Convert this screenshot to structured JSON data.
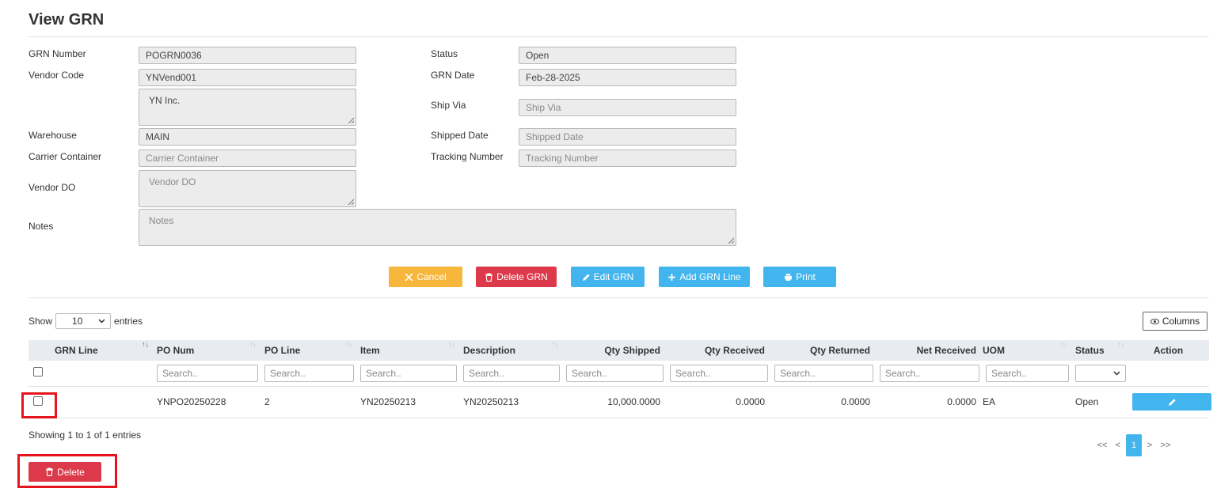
{
  "page": {
    "title": "View GRN"
  },
  "form": {
    "grn_number_label": "GRN Number",
    "grn_number": "POGRN0036",
    "vendor_code_label": "Vendor Code",
    "vendor_code": "YNVend001",
    "vendor_name": "YN Inc.",
    "warehouse_label": "Warehouse",
    "warehouse": "MAIN",
    "carrier_container_label": "Carrier Container",
    "carrier_container_placeholder": "Carrier Container",
    "vendor_do_label": "Vendor DO",
    "vendor_do_placeholder": "Vendor DO",
    "notes_label": "Notes",
    "notes_placeholder": "Notes",
    "status_label": "Status",
    "status": "Open",
    "grn_date_label": "GRN Date",
    "grn_date": "Feb-28-2025",
    "ship_via_label": "Ship Via",
    "ship_via_placeholder": "Ship Via",
    "shipped_date_label": "Shipped Date",
    "shipped_date_placeholder": "Shipped Date",
    "tracking_number_label": "Tracking Number",
    "tracking_number_placeholder": "Tracking Number"
  },
  "actions": {
    "cancel": "Cancel",
    "delete_grn": "Delete GRN",
    "edit_grn": "Edit GRN",
    "add_grn_line": "Add GRN Line",
    "print": "Print"
  },
  "table_controls": {
    "show_label": "Show",
    "entries_value": "10",
    "entries_label": "entries",
    "columns_button": "Columns",
    "search_placeholder": "Search.."
  },
  "table": {
    "headers": {
      "grn_line": "GRN Line",
      "po_num": "PO Num",
      "po_line": "PO Line",
      "item": "Item",
      "description": "Description",
      "qty_shipped": "Qty Shipped",
      "qty_received": "Qty Received",
      "qty_returned": "Qty Returned",
      "net_received": "Net Received",
      "uom": "UOM",
      "status": "Status",
      "action": "Action"
    },
    "rows": [
      {
        "grn_line": "",
        "po_num": "YNPO20250228",
        "po_line": "2",
        "item": "YN20250213",
        "description": "YN20250213",
        "qty_shipped": "10,000.0000",
        "qty_received": "0.0000",
        "qty_returned": "0.0000",
        "net_received": "0.0000",
        "uom": "EA",
        "status": "Open"
      }
    ]
  },
  "footer": {
    "showing": "Showing 1 to 1 of 1 entries",
    "delete_button": "Delete",
    "pager_first": "<<",
    "pager_prev": "<",
    "pager_current": "1",
    "pager_next": ">",
    "pager_last": ">>"
  },
  "colors": {
    "warning": "#f6b73c",
    "danger": "#dc3a4b",
    "info": "#43b5ee",
    "highlight": "#e6141c"
  }
}
